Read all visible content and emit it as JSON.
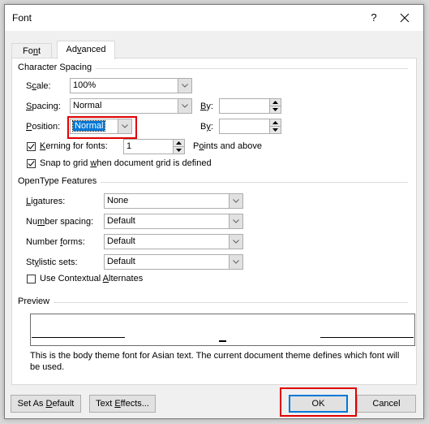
{
  "window": {
    "title": "Font",
    "help_label": "?",
    "close_icon": "close-icon"
  },
  "tabs": [
    {
      "label": "Font",
      "underline": "n",
      "active": false
    },
    {
      "label": "Advanced",
      "underline": "v",
      "active": true
    }
  ],
  "character_spacing": {
    "section_label": "Character Spacing",
    "scale": {
      "label": "Scale:",
      "value": "100%"
    },
    "spacing": {
      "label": "Spacing:",
      "value": "Normal",
      "by_label": "By:",
      "by_value": ""
    },
    "position": {
      "label": "Position:",
      "value": "Normal",
      "by_label": "By:",
      "by_value": ""
    },
    "kerning": {
      "label": "Kerning for fonts:",
      "checked": true,
      "value": "1",
      "suffix": "Points and above"
    },
    "snap_to_grid": {
      "label": "Snap to grid when document grid is defined",
      "checked": true
    }
  },
  "opentype": {
    "section_label": "OpenType Features",
    "ligatures": {
      "label": "Ligatures:",
      "value": "None"
    },
    "number_spacing": {
      "label": "Number spacing:",
      "value": "Default"
    },
    "number_forms": {
      "label": "Number forms:",
      "value": "Default"
    },
    "stylistic_sets": {
      "label": "Stylistic sets:",
      "value": "Default"
    },
    "contextual_alternates": {
      "label": "Use Contextual Alternates",
      "checked": false
    }
  },
  "preview": {
    "section_label": "Preview",
    "description": "This is the body theme font for Asian text. The current document theme defines which font will be used."
  },
  "buttons": {
    "set_as_default": "Set As Default",
    "text_effects": "Text Effects...",
    "ok": "OK",
    "cancel": "Cancel"
  },
  "colors": {
    "highlight_red": "#e00000",
    "focus_blue": "#0078d7",
    "selection_blue": "#0078d7"
  }
}
